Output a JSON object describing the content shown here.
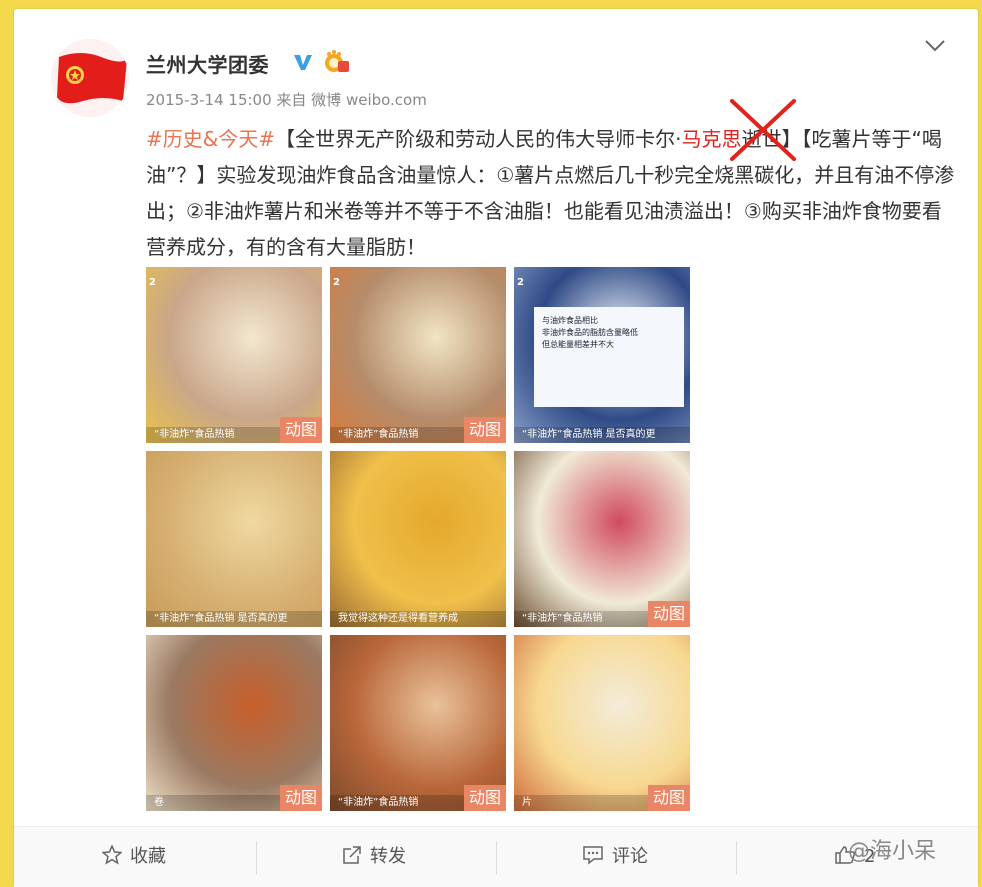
{
  "account": {
    "name": "兰州大学团委",
    "time": "2015-3-14 15:00",
    "source": "来自 微博 weibo.com"
  },
  "post": {
    "tag": "#历史&今天#",
    "headline_a": "【全世界无产阶级和劳动人民的伟大导师卡尔·",
    "headline_red": "马克思",
    "headline_b": "逝世】",
    "body": "【吃薯片等于“喝油”？】实验发现油炸食品含油量惊人：①薯片点燃后几十秒完全烧黑碳化，并且有油不停渗出；②非油炸薯片和米卷等并不等于不含油脂！也能看见油渍溢出！③购买非油炸食物要看营养成分，有的含有大量脂肪！"
  },
  "images": [
    {
      "caption": "“非油炸”食品热销",
      "label": "动图",
      "num": "2",
      "colors": [
        "#c9a68a",
        "#f2e7cf",
        "#e9c24a"
      ]
    },
    {
      "caption": "“非油炸”食品热销",
      "label": "动图",
      "num": "2",
      "colors": [
        "#b58c6b",
        "#f1e5c4",
        "#d97a3b"
      ]
    },
    {
      "caption": "“非油炸”食品热销 是否真的更",
      "label": "",
      "num": "2",
      "colors": [
        "#2f4a86",
        "#f2f6fb",
        "#8aa1c9"
      ],
      "screen": [
        "与油炸食品相比",
        "非油炸食品的脂肪含量略低",
        "但总能量相差并不大"
      ]
    },
    {
      "caption": "“非油炸”食品热销 是否真的更",
      "label": "",
      "num": "",
      "colors": [
        "#d7b173",
        "#efd9a1",
        "#c79a58"
      ]
    },
    {
      "caption": "我觉得这种还是得看营养成",
      "label": "",
      "num": "",
      "colors": [
        "#f0c04b",
        "#e4a82c",
        "#9a6a34"
      ]
    },
    {
      "caption": "“非油炸”食品热销",
      "label": "动图",
      "num": "",
      "colors": [
        "#f0ead6",
        "#d14a5e",
        "#6b4a2e"
      ]
    },
    {
      "caption": "卷",
      "label": "动图",
      "num": "",
      "colors": [
        "#9a7a62",
        "#c85e2a",
        "#f1e3cc"
      ]
    },
    {
      "caption": "“非油炸”食品热销",
      "label": "动图",
      "num": "",
      "colors": [
        "#b9673a",
        "#e9c29a",
        "#7c4a2c"
      ]
    },
    {
      "caption": "片",
      "label": "动图",
      "num": "",
      "colors": [
        "#f7d890",
        "#f3ecd9",
        "#d06a3c"
      ]
    }
  ],
  "actions": {
    "favorite": "收藏",
    "repost": "转发",
    "comment": "评论",
    "like": "2"
  },
  "watermark": "@海小呆",
  "colors": {
    "background": "#f3d94b",
    "tag": "#eb7350",
    "highlight": "#e5211b",
    "gif_badge": "#e98666"
  }
}
